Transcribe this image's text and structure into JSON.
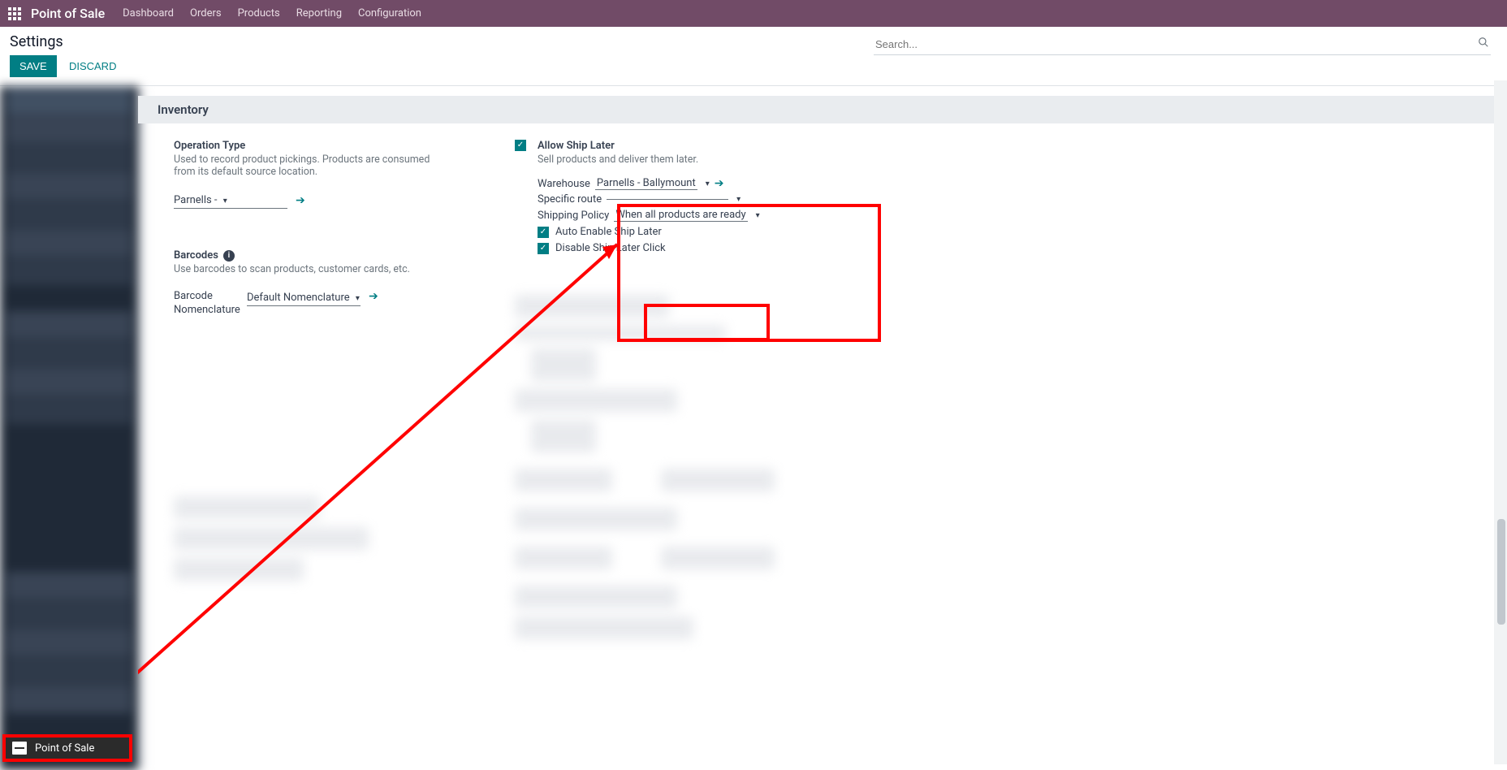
{
  "app_name": "Point of Sale",
  "nav": {
    "items": [
      "Dashboard",
      "Orders",
      "Products",
      "Reporting",
      "Configuration"
    ]
  },
  "breadcrumb": {
    "title": "Settings"
  },
  "actions": {
    "save": "SAVE",
    "discard": "DISCARD"
  },
  "search": {
    "placeholder": "Search..."
  },
  "section": {
    "inventory": "Inventory"
  },
  "left": {
    "operation_type": {
      "title": "Operation Type",
      "desc": "Used to record product pickings. Products are consumed from its default source location.",
      "value": "Parnells - "
    },
    "barcodes": {
      "title": "Barcodes",
      "desc": "Use barcodes to scan products, customer cards, etc.",
      "nomenclature_label": "Barcode Nomenclature",
      "nomenclature_value": "Default Nomenclature"
    }
  },
  "right": {
    "allow_ship_later": {
      "title": "Allow Ship Later",
      "desc": "Sell products and deliver them later.",
      "warehouse_label": "Warehouse",
      "warehouse_value": "Parnells - Ballymount",
      "route_label": "Specific route",
      "route_value": "",
      "shipping_policy_label": "Shipping Policy",
      "shipping_policy_value": "When all products are ready",
      "auto_enable_label": "Auto Enable Ship Later",
      "disable_click_label": "Disable Ship Later Click"
    }
  },
  "taskbar": {
    "label": "Point of Sale"
  },
  "colors": {
    "brand": "#714B67",
    "primary": "#017e84",
    "annotation": "#ff0000"
  }
}
